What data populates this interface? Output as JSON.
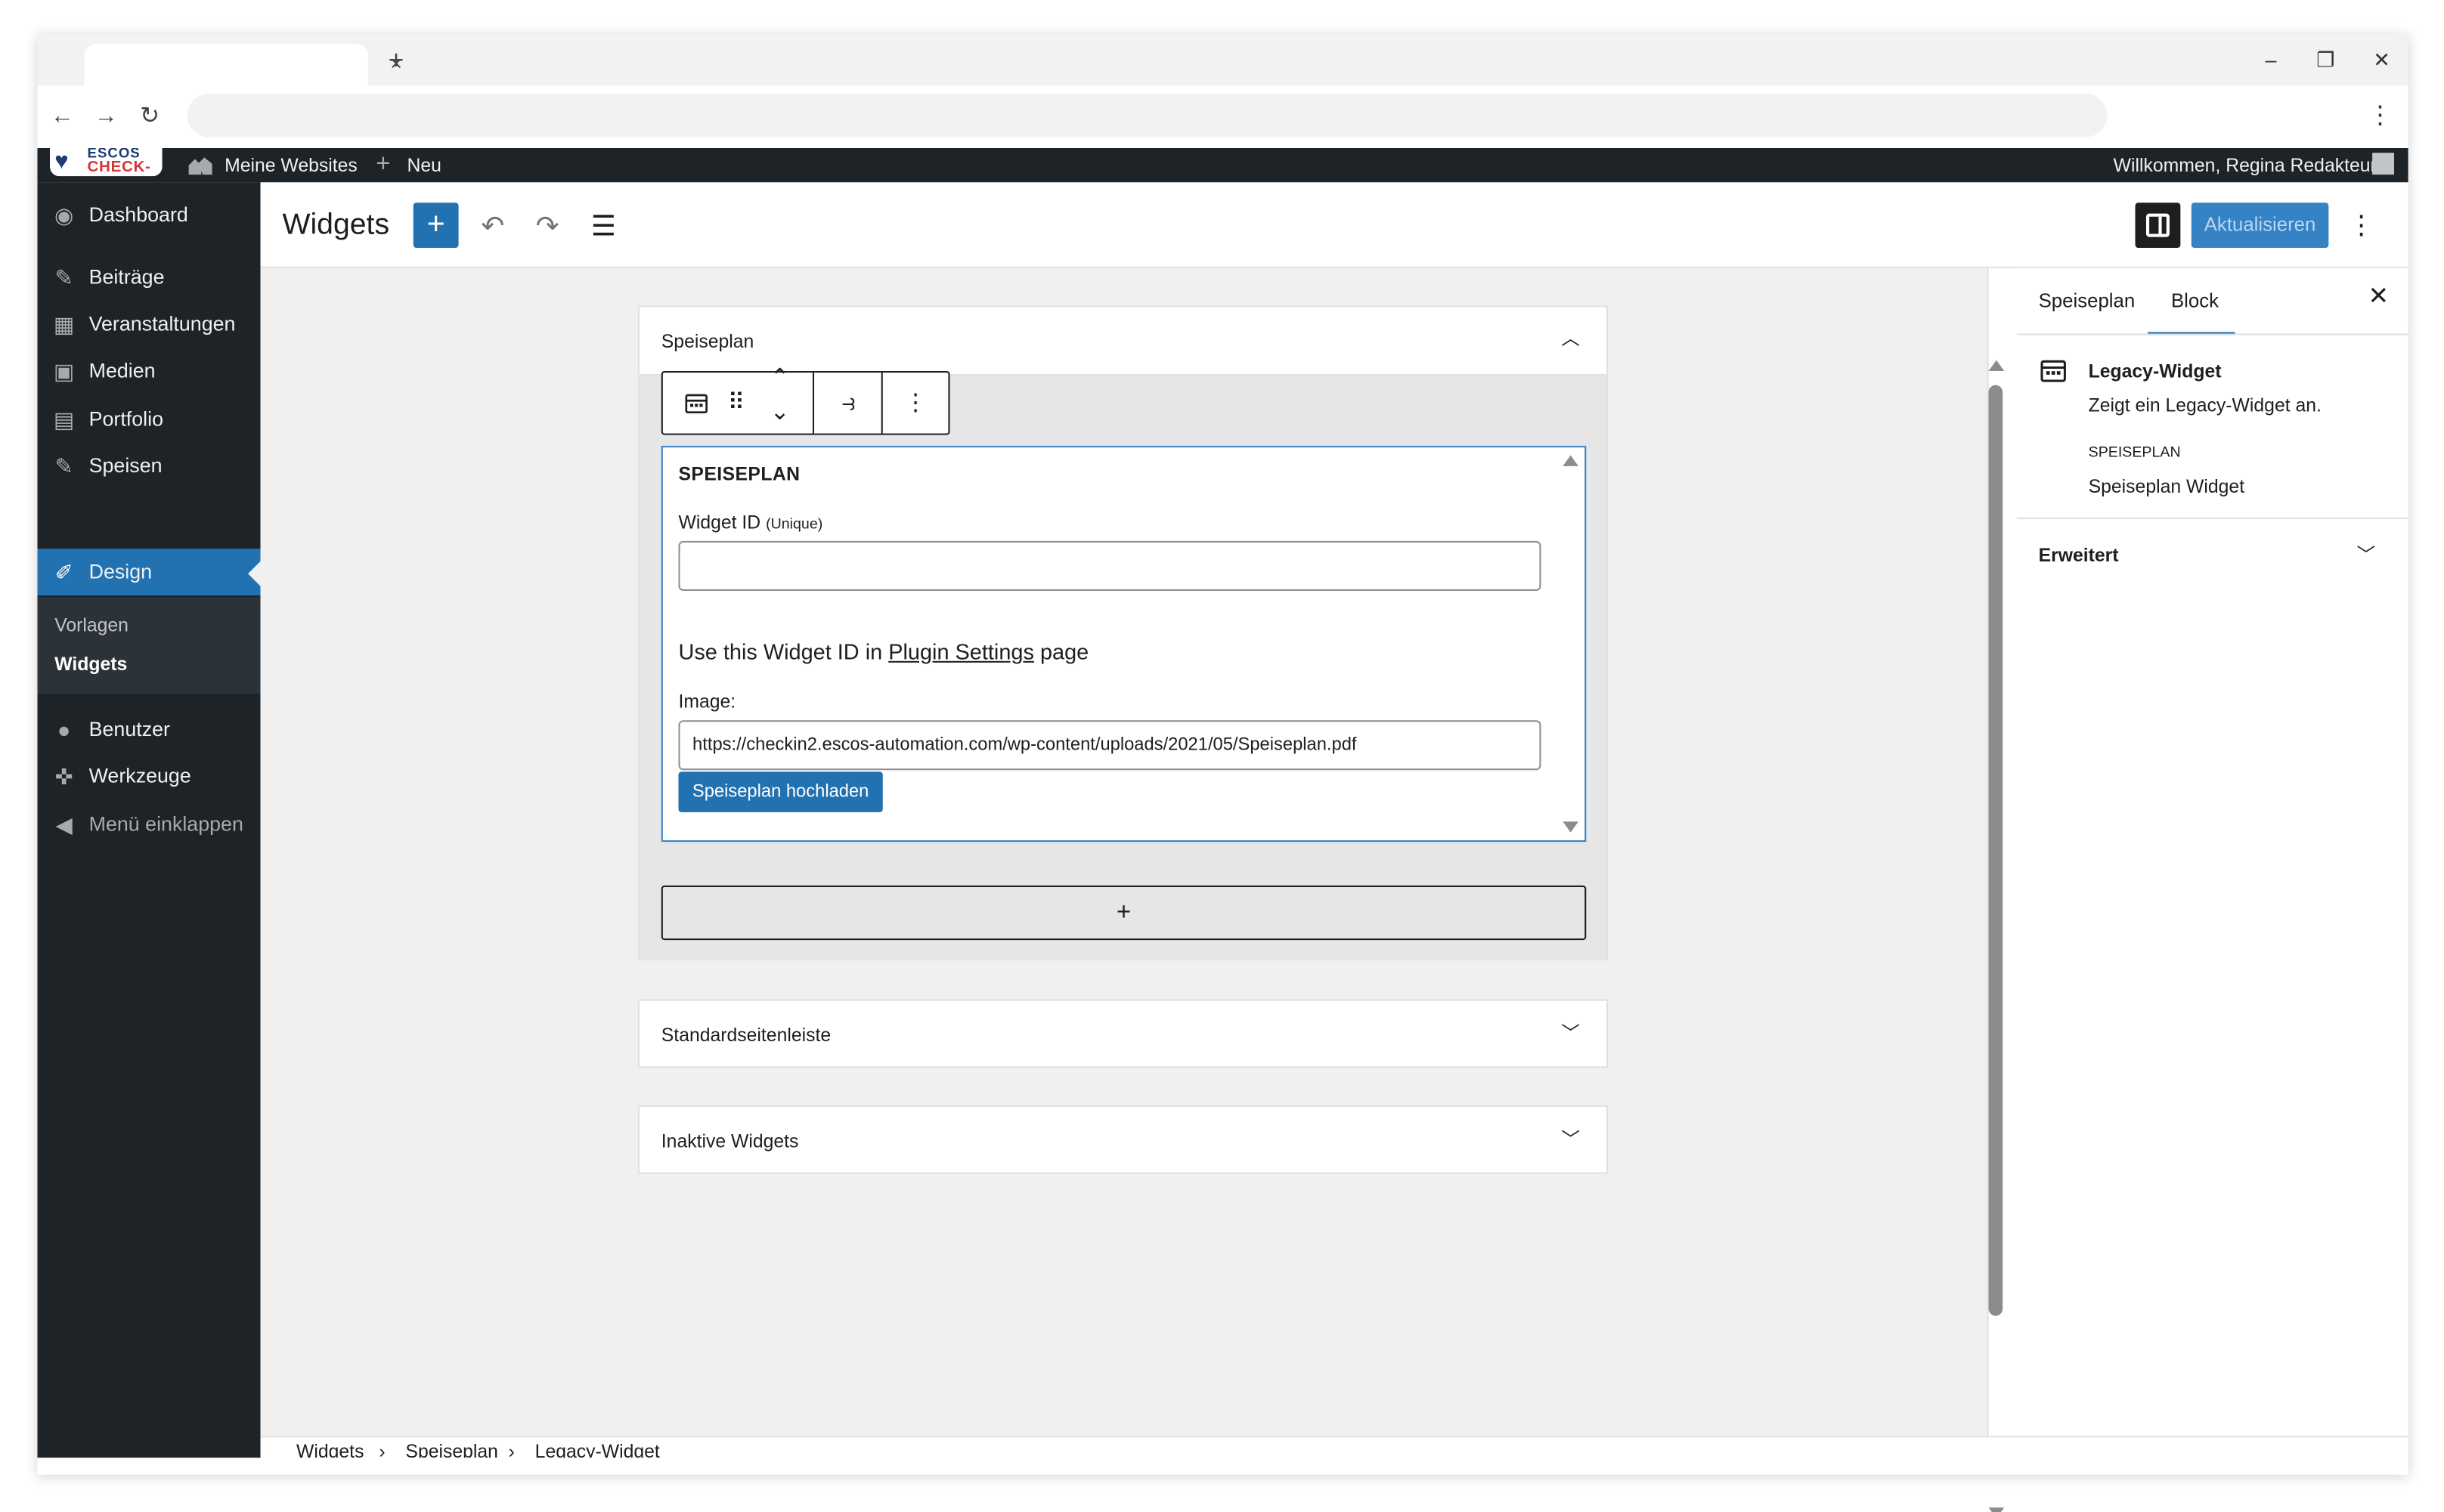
{
  "browser": {
    "tab_close": "×",
    "new_tab": "+",
    "minimize": "–",
    "restore": "❐",
    "close": "✕",
    "back": "←",
    "forward": "→",
    "reload": "↻",
    "menu": "⋮"
  },
  "adminbar": {
    "logo_line1": "ESCOS",
    "logo_line2": "CHECK-IN",
    "my_sites": "Meine Websites",
    "new": "Neu",
    "welcome": "Willkommen, Regina Redakteur"
  },
  "sidebar": {
    "items": [
      {
        "label": "Dashboard",
        "icon": "dashboard-icon"
      },
      {
        "label": "Beiträge",
        "icon": "pin-icon"
      },
      {
        "label": "Veranstaltungen",
        "icon": "calendar-icon"
      },
      {
        "label": "Medien",
        "icon": "media-icon"
      },
      {
        "label": "Portfolio",
        "icon": "portfolio-icon"
      },
      {
        "label": "Speisen",
        "icon": "pin-icon"
      },
      {
        "label": "Design",
        "icon": "brush-icon"
      },
      {
        "label": "Benutzer",
        "icon": "user-icon"
      },
      {
        "label": "Werkzeuge",
        "icon": "wrench-icon"
      },
      {
        "label": "Menü einklappen",
        "icon": "collapse-icon"
      }
    ],
    "submenu": [
      "Vorlagen",
      "Widgets"
    ]
  },
  "header": {
    "title": "Widgets",
    "add": "+",
    "undo": "↶",
    "redo": "↷",
    "list_view": "☰",
    "save": "Aktualisieren",
    "options": "⋮"
  },
  "areas": [
    {
      "title": "Speiseplan",
      "expanded": true
    },
    {
      "title": "Standardseitenleiste",
      "expanded": false
    },
    {
      "title": "Inaktive Widgets",
      "expanded": false
    }
  ],
  "block_toolbar": {
    "drag": "⠿",
    "move_up": "⌃",
    "move_down": "⌄",
    "transform": "⥽",
    "more": "⋮"
  },
  "widget": {
    "title": "SPEISEPLAN",
    "id_label": "Widget ID",
    "id_hint": "(Unique)",
    "id_value": "",
    "info_prefix": "Use this Widget ID in ",
    "info_link": "Plugin Settings",
    "info_suffix": " page",
    "image_label": "Image:",
    "image_value": "https://checkin2.escos-automation.com/wp-content/uploads/2021/05/Speiseplan.pdf",
    "upload_button": "Speiseplan hochladen"
  },
  "appender": "+",
  "settings": {
    "tabs": [
      "Speiseplan",
      "Block"
    ],
    "active_tab": "Block",
    "close": "✕",
    "block_name": "Legacy-Widget",
    "block_desc": "Zeigt ein Legacy-Widget an.",
    "widget_type_label": "SPEISEPLAN",
    "widget_type_value": "Speiseplan Widget",
    "advanced": "Erweitert"
  },
  "breadcrumb": [
    "Widgets",
    "Speiseplan",
    "Legacy-Widget"
  ],
  "breadcrumb_sep": "›",
  "colors": {
    "accent": "#2271b1",
    "admin_dark": "#1d2327",
    "canvas_bg": "#f0f0f0"
  }
}
